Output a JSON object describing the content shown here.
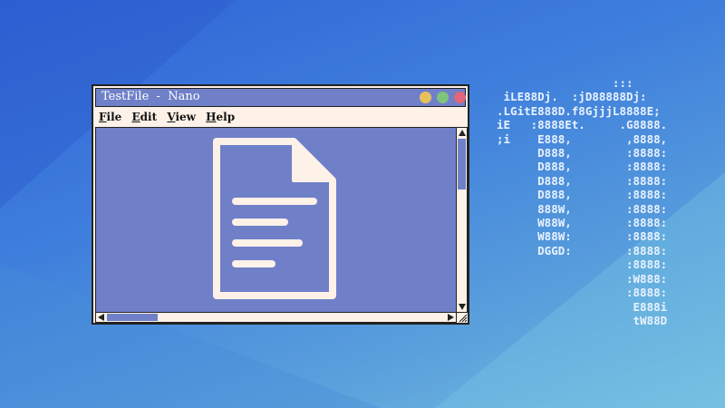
{
  "window": {
    "title": "TestFile  -  Nano",
    "controls": [
      "minimize-button",
      "maximize-button",
      "close-button"
    ]
  },
  "menu": [
    {
      "mnemonic": "F",
      "rest": "ile"
    },
    {
      "mnemonic": "E",
      "rest": "dit"
    },
    {
      "mnemonic": "V",
      "rest": "iew"
    },
    {
      "mnemonic": "H",
      "rest": "elp"
    }
  ],
  "editor": {
    "icon": "document-icon"
  },
  "ascii_art": "                 :::\n iLE88Dj.  :jD88888Dj:\n.LGitE888D.f8GjjjL8888E;\niE   :8888Et.     .G8888.\n;i    E888,        ,8888,\n      D888,        :8888:\n      D888,        :8888:\n      D888,        :8888:\n      D888,        :8888:\n      888W,        :8888:\n      W88W,        :8888:\n      W88W:        :8888:\n      DGGD:        :8888:\n                   :8888:\n                   :W888:\n                   :8888:\n                    E888i\n                    tW88D",
  "colors": {
    "window_accent": "#6f80c9",
    "window_bg": "#fdf1e8",
    "minimize": "#e8c05a",
    "maximize": "#7fc47a",
    "close": "#e0667c"
  }
}
